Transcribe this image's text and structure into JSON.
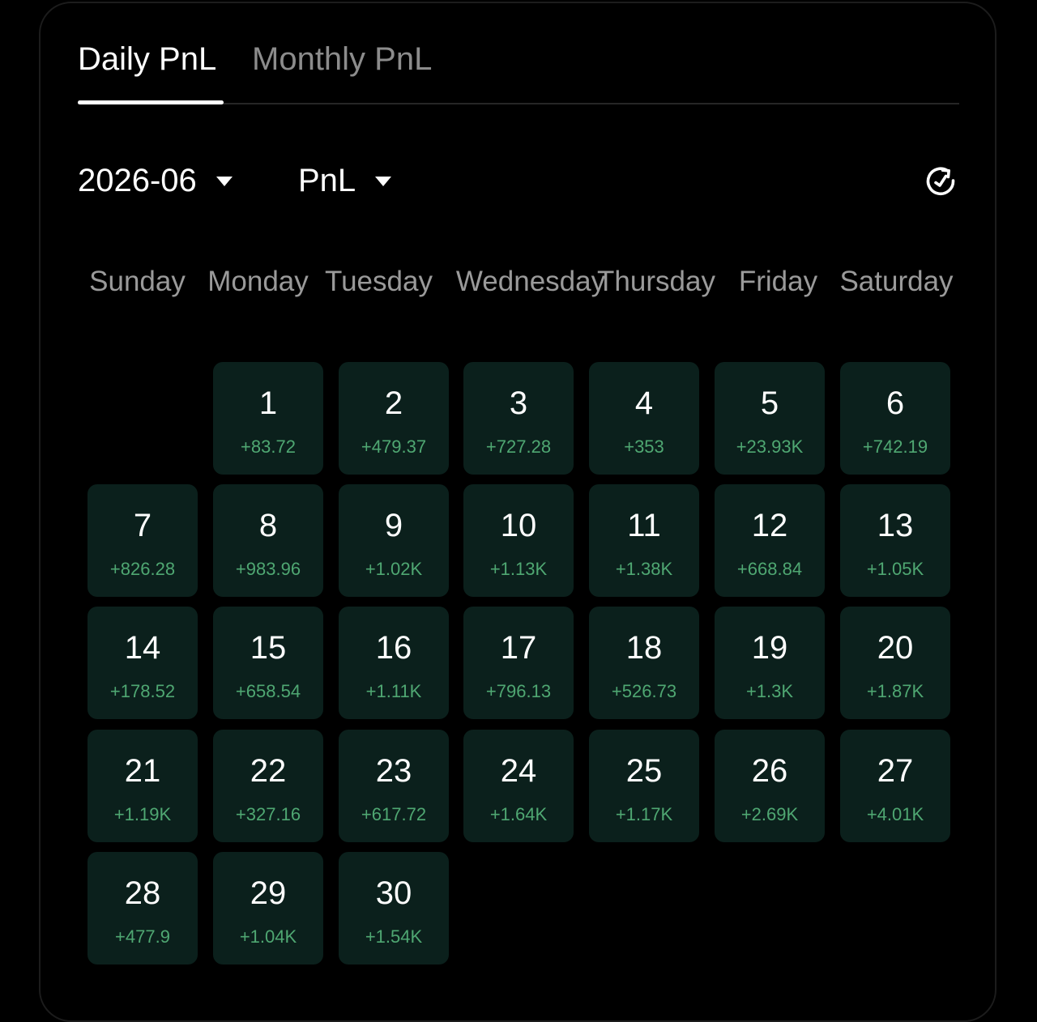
{
  "tabs": [
    {
      "label": "Daily PnL",
      "active": true
    },
    {
      "label": "Monthly PnL",
      "active": false
    }
  ],
  "controls": {
    "month": "2026-06",
    "metric": "PnL",
    "refresh_icon": "refresh-icon"
  },
  "weekdays": [
    "Sunday",
    "Monday",
    "Tuesday",
    "Wednesday",
    "Thursday",
    "Friday",
    "Saturday"
  ],
  "calendar": {
    "first_weekday_index": 1,
    "days": [
      {
        "day": "1",
        "pnl": "+83.72"
      },
      {
        "day": "2",
        "pnl": "+479.37"
      },
      {
        "day": "3",
        "pnl": "+727.28"
      },
      {
        "day": "4",
        "pnl": "+353"
      },
      {
        "day": "5",
        "pnl": "+23.93K"
      },
      {
        "day": "6",
        "pnl": "+742.19"
      },
      {
        "day": "7",
        "pnl": "+826.28"
      },
      {
        "day": "8",
        "pnl": "+983.96"
      },
      {
        "day": "9",
        "pnl": "+1.02K"
      },
      {
        "day": "10",
        "pnl": "+1.13K"
      },
      {
        "day": "11",
        "pnl": "+1.38K"
      },
      {
        "day": "12",
        "pnl": "+668.84"
      },
      {
        "day": "13",
        "pnl": "+1.05K"
      },
      {
        "day": "14",
        "pnl": "+178.52"
      },
      {
        "day": "15",
        "pnl": "+658.54"
      },
      {
        "day": "16",
        "pnl": "+1.11K"
      },
      {
        "day": "17",
        "pnl": "+796.13"
      },
      {
        "day": "18",
        "pnl": "+526.73"
      },
      {
        "day": "19",
        "pnl": "+1.3K"
      },
      {
        "day": "20",
        "pnl": "+1.87K"
      },
      {
        "day": "21",
        "pnl": "+1.19K"
      },
      {
        "day": "22",
        "pnl": "+327.16"
      },
      {
        "day": "23",
        "pnl": "+617.72"
      },
      {
        "day": "24",
        "pnl": "+1.64K"
      },
      {
        "day": "25",
        "pnl": "+1.17K"
      },
      {
        "day": "26",
        "pnl": "+2.69K"
      },
      {
        "day": "27",
        "pnl": "+4.01K"
      },
      {
        "day": "28",
        "pnl": "+477.9"
      },
      {
        "day": "29",
        "pnl": "+1.04K"
      },
      {
        "day": "30",
        "pnl": "+1.54K"
      }
    ]
  },
  "colors": {
    "background": "#000000",
    "cell_background": "#0b201c",
    "positive": "#4fa772",
    "tab_inactive": "#8c8c8c",
    "weekday_text": "#9a9a9a"
  }
}
